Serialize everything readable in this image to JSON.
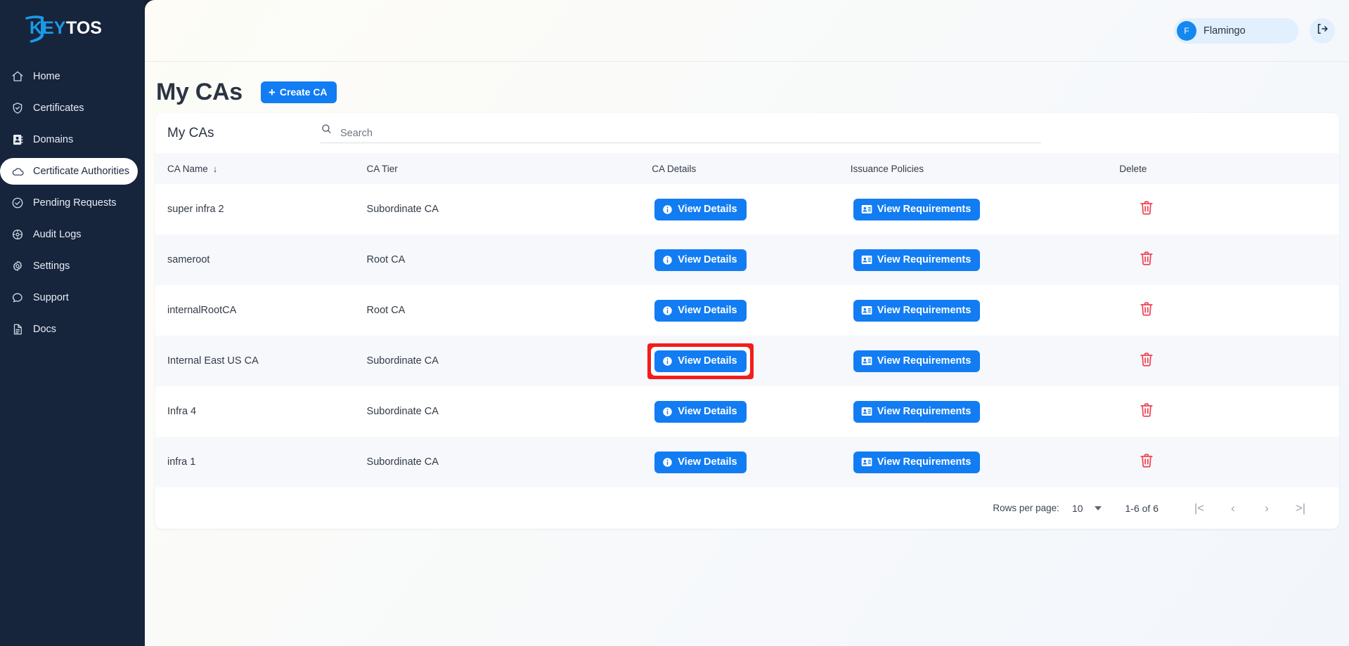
{
  "brand": {
    "name_primary": "KEY",
    "name_secondary": "TOS"
  },
  "sidebar": {
    "items": [
      {
        "label": "Home",
        "icon": "home-icon",
        "active": false
      },
      {
        "label": "Certificates",
        "icon": "shield-check-icon",
        "active": false
      },
      {
        "label": "Domains",
        "icon": "address-book-icon",
        "active": false
      },
      {
        "label": "Certificate Authorities",
        "icon": "cloud-icon",
        "active": true
      },
      {
        "label": "Pending Requests",
        "icon": "check-circle-icon",
        "active": false
      },
      {
        "label": "Audit Logs",
        "icon": "compass-icon",
        "active": false
      },
      {
        "label": "Settings",
        "icon": "gear-icon",
        "active": false
      },
      {
        "label": "Support",
        "icon": "chat-bubble-icon",
        "active": false
      },
      {
        "label": "Docs",
        "icon": "document-icon",
        "active": false
      }
    ]
  },
  "topbar": {
    "user_initial": "F",
    "user_name": "Flamingo",
    "logout_icon": "logout-icon"
  },
  "page": {
    "title": "My CAs",
    "create_button_label": "Create CA",
    "create_button_plus": "+"
  },
  "card": {
    "title": "My CAs",
    "search_placeholder": "Search",
    "search_value": "",
    "columns": [
      {
        "label": "CA Name",
        "sort": "↓"
      },
      {
        "label": "CA Tier"
      },
      {
        "label": "CA Details"
      },
      {
        "label": "Issuance Policies"
      },
      {
        "label": "Delete"
      }
    ],
    "details_button_label": "View Details",
    "requirements_button_label": "View Requirements",
    "rows": [
      {
        "name": "super infra 2",
        "tier": "Subordinate CA",
        "highlighted": false
      },
      {
        "name": "sameroot",
        "tier": "Root CA",
        "highlighted": false
      },
      {
        "name": "internalRootCA",
        "tier": "Root CA",
        "highlighted": false
      },
      {
        "name": "Internal East US CA",
        "tier": "Subordinate CA",
        "highlighted": true
      },
      {
        "name": "Infra 4",
        "tier": "Subordinate CA",
        "highlighted": false
      },
      {
        "name": "infra 1",
        "tier": "Subordinate CA",
        "highlighted": false
      }
    ]
  },
  "pagination": {
    "rows_per_page_label": "Rows per page:",
    "rows_per_page_value": "10",
    "range_label": "1-6 of 6",
    "first_label": "|<",
    "prev_label": "‹",
    "next_label": "›",
    "last_label": ">|"
  },
  "colors": {
    "sidebar_bg": "#16243c",
    "accent_blue": "#127cf3",
    "avatar_blue": "#1389ef",
    "chip_bg": "#e2effc",
    "highlight_red": "#f41c1c",
    "trash_red": "#ef4352",
    "row_alt_bg": "#f6f8fc",
    "header_row_bg": "#f7f8fc"
  }
}
